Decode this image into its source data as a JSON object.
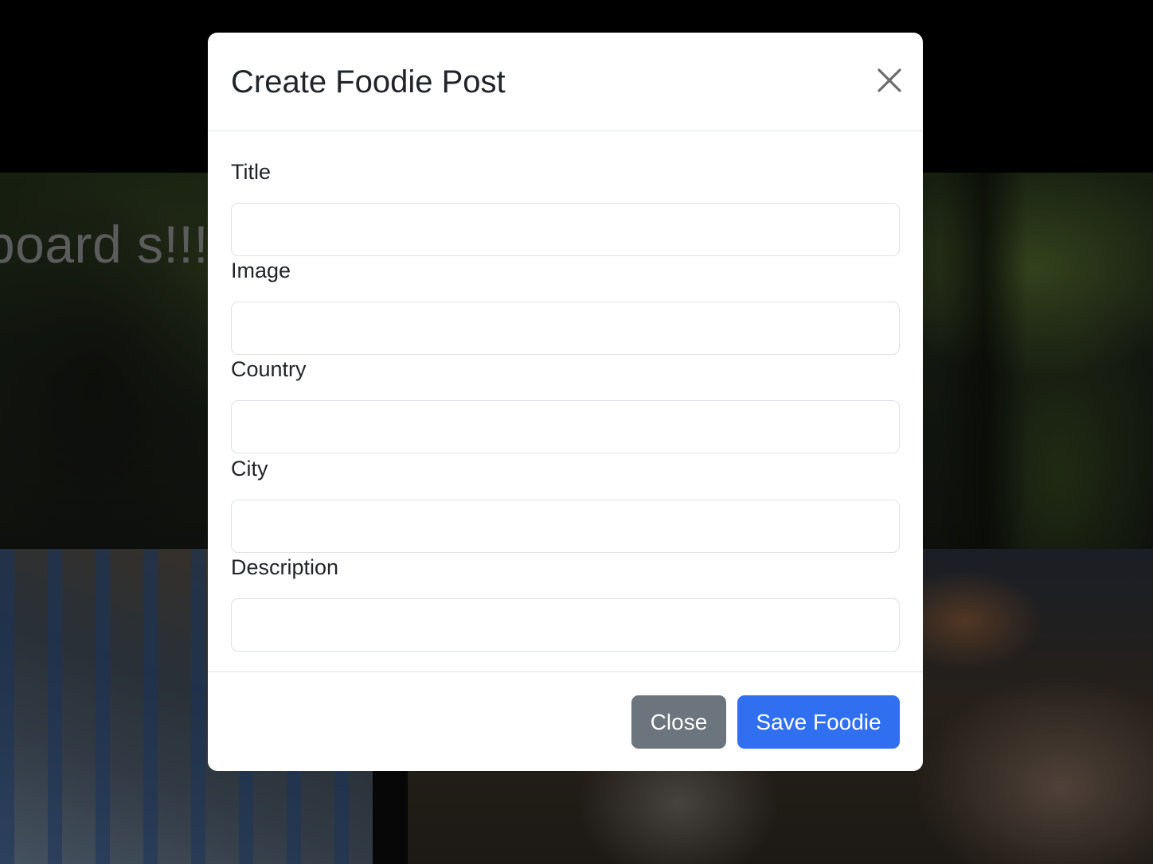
{
  "background": {
    "headline": "ashboard                                                      s!!!"
  },
  "modal": {
    "title": "Create Foodie Post",
    "close_icon": "close-icon",
    "fields": [
      {
        "label": "Title",
        "value": "",
        "placeholder": ""
      },
      {
        "label": "Image",
        "value": "",
        "placeholder": ""
      },
      {
        "label": "Country",
        "value": "",
        "placeholder": ""
      },
      {
        "label": "City",
        "value": "",
        "placeholder": ""
      },
      {
        "label": "Description",
        "value": "",
        "placeholder": ""
      }
    ],
    "footer": {
      "close_label": "Close",
      "save_label": "Save Foodie"
    }
  },
  "colors": {
    "primary": "#2f6ff0",
    "secondary": "#6c757d",
    "text": "#212529",
    "border": "#dee2e6"
  }
}
